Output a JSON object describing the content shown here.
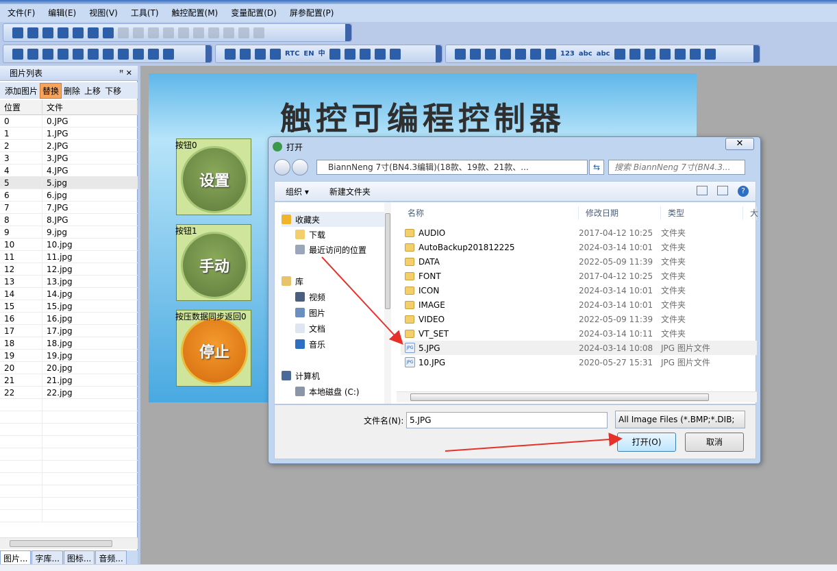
{
  "menubar": [
    "文件(F)",
    "编辑(E)",
    "视图(V)",
    "工具(T)",
    "触控配置(M)",
    "变量配置(D)",
    "屏参配置(P)"
  ],
  "toolbar": {
    "icons_row1": [
      "new-icon",
      "open-folder-icon",
      "save-icon",
      "cut-icon",
      "copy-icon",
      "paste-icon",
      "undo-icon",
      "align-left-icon",
      "align-right-icon",
      "align-top-icon",
      "align-bottom-icon",
      "align-center-icon",
      "distribute-icon",
      "bring-front-icon",
      "send-back-icon",
      "group-icon",
      "ungroup-icon"
    ],
    "icons_row2_a": [
      "keyboard-icon",
      "import-icon",
      "download-icon",
      "preview-icon",
      "excel-icon",
      "text-icon",
      "page-icon",
      "input-icon",
      "calculator-icon",
      "edit-icon",
      "zoom-icon"
    ],
    "row2_b_text": [
      "RTC",
      "EN",
      "中"
    ],
    "icons_row3_text": [
      "123",
      "abc",
      "abc"
    ]
  },
  "left_panel": {
    "title": "图片列表",
    "pin": "ꟸ ✕",
    "tools": [
      "添加图片",
      "替换",
      "删除",
      "上移",
      "下移"
    ],
    "active_tool": "替换",
    "columns": [
      "位置",
      "文件"
    ],
    "rows": [
      [
        "0",
        "0.JPG"
      ],
      [
        "1",
        "1.JPG"
      ],
      [
        "2",
        "2.JPG"
      ],
      [
        "3",
        "3.JPG"
      ],
      [
        "4",
        "4.JPG"
      ],
      [
        "5",
        "5.jpg"
      ],
      [
        "6",
        "6.jpg"
      ],
      [
        "7",
        "7.JPG"
      ],
      [
        "8",
        "8.JPG"
      ],
      [
        "9",
        "9.jpg"
      ],
      [
        "10",
        "10.jpg"
      ],
      [
        "11",
        "11.jpg"
      ],
      [
        "12",
        "12.jpg"
      ],
      [
        "13",
        "13.jpg"
      ],
      [
        "14",
        "14.jpg"
      ],
      [
        "15",
        "15.jpg"
      ],
      [
        "16",
        "16.jpg"
      ],
      [
        "17",
        "17.jpg"
      ],
      [
        "18",
        "18.jpg"
      ],
      [
        "19",
        "19.jpg"
      ],
      [
        "20",
        "20.jpg"
      ],
      [
        "21",
        "21.jpg"
      ],
      [
        "22",
        "22.jpg"
      ]
    ],
    "selected_row": "5",
    "tabs": [
      "图片...",
      "字库...",
      "图标...",
      "音频..."
    ]
  },
  "hmi": {
    "title": "触控可编程控制器",
    "buttons": [
      {
        "tag": "按钮0",
        "text": "设置"
      },
      {
        "tag": "按钮1",
        "text": "手动"
      },
      {
        "tag": "按压数据同步返回0",
        "text": "停止"
      }
    ]
  },
  "dialog": {
    "title": "打开",
    "close": "✕",
    "address": "BiannNeng 7寸(BN4.3编辑)(18款、19款、21款、...",
    "search_placeholder": "搜索 BiannNeng 7寸(BN4.3...",
    "organize": "组织 ▾",
    "new_folder": "新建文件夹",
    "nav": {
      "favorites": "收藏夹",
      "downloads": "下载",
      "recent": "最近访问的位置",
      "libraries": "库",
      "videos": "视频",
      "pictures": "图片",
      "documents": "文档",
      "music": "音乐",
      "computer": "计算机",
      "local_disk": "本地磁盘 (C:)"
    },
    "columns": [
      "名称",
      "修改日期",
      "类型",
      "大"
    ],
    "files": [
      {
        "name": "AUDIO",
        "date": "2017-04-12 10:25",
        "type": "文件夹",
        "kind": "folder"
      },
      {
        "name": "AutoBackup201812225",
        "date": "2024-03-14 10:01",
        "type": "文件夹",
        "kind": "folder"
      },
      {
        "name": "DATA",
        "date": "2022-05-09 11:39",
        "type": "文件夹",
        "kind": "folder"
      },
      {
        "name": "FONT",
        "date": "2017-04-12 10:25",
        "type": "文件夹",
        "kind": "folder"
      },
      {
        "name": "ICON",
        "date": "2024-03-14 10:01",
        "type": "文件夹",
        "kind": "folder"
      },
      {
        "name": "IMAGE",
        "date": "2024-03-14 10:01",
        "type": "文件夹",
        "kind": "folder"
      },
      {
        "name": "VIDEO",
        "date": "2022-05-09 11:39",
        "type": "文件夹",
        "kind": "folder"
      },
      {
        "name": "VT_SET",
        "date": "2024-03-14 10:11",
        "type": "文件夹",
        "kind": "folder"
      },
      {
        "name": "5.JPG",
        "date": "2024-03-14 10:08",
        "type": "JPG 图片文件",
        "kind": "jpg"
      },
      {
        "name": "10.JPG",
        "date": "2020-05-27 15:31",
        "type": "JPG 图片文件",
        "kind": "jpg"
      }
    ],
    "selected_file": "5.JPG",
    "filename_label": "文件名(N):",
    "filename_value": "5.JPG",
    "filetype": "All Image Files (*.BMP;*.DIB;",
    "open_label": "打开(O)",
    "cancel_label": "取消"
  },
  "colors": {
    "accent_arrow": "#e8302a",
    "active_tool": "#f6a35b"
  }
}
